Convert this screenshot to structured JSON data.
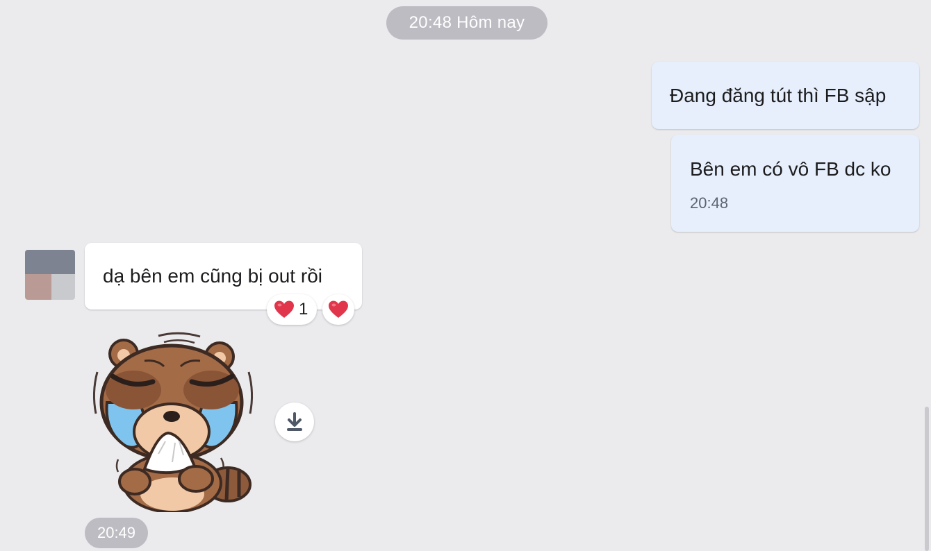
{
  "chat": {
    "date_separator": "20:48 Hôm nay",
    "messages": [
      {
        "direction": "outgoing",
        "text": "Đang đăng tút thì FB sập"
      },
      {
        "direction": "outgoing",
        "text": "Bên em có vô FB dc ko",
        "time": "20:48"
      },
      {
        "direction": "incoming",
        "text": "dạ bên em cũng bị out rồi",
        "reaction": {
          "icon": "heart-icon",
          "count": "1"
        },
        "react_button_icon": "heart-icon"
      },
      {
        "direction": "incoming",
        "sticker": "crying-raccoon-sticker",
        "download_icon": "download-icon",
        "time": "20:49"
      }
    ]
  },
  "colors": {
    "background": "#ebebee",
    "outgoing_bubble": "#e6effb",
    "incoming_bubble": "#ffffff",
    "pill": "#bcbcc2",
    "heart": "#e0354a"
  }
}
